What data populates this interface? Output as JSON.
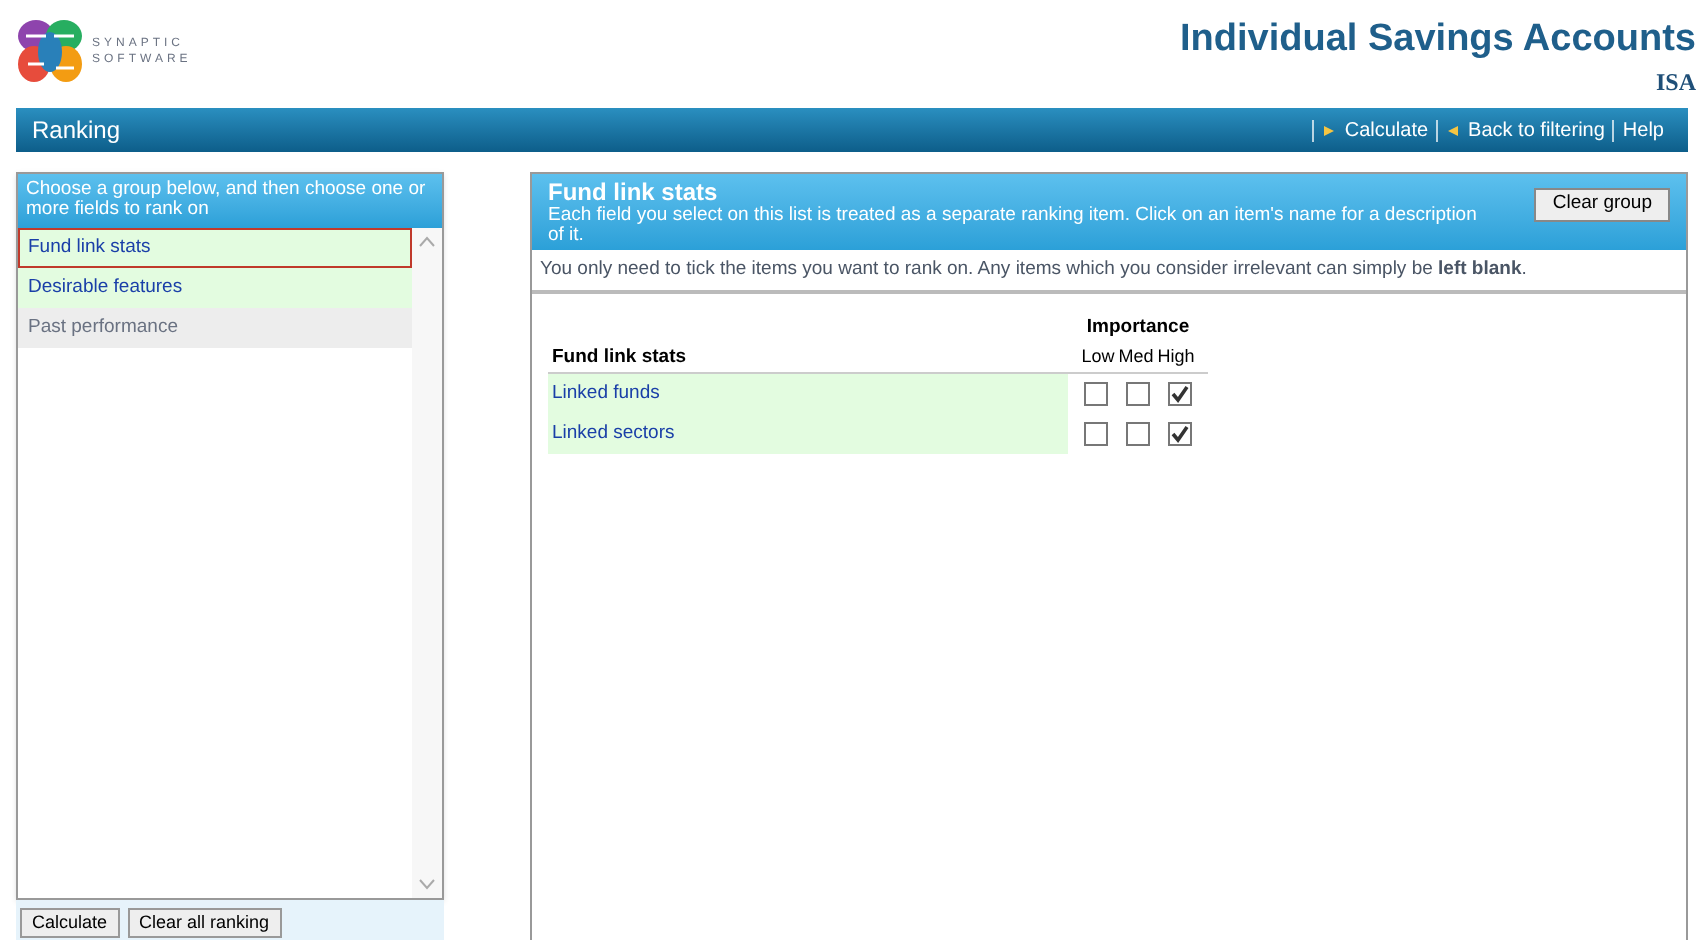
{
  "brand": {
    "line_1": "SYNAPTIC",
    "line_2": "SOFTWARE"
  },
  "header": {
    "title": "Individual Savings Accounts",
    "subtitle": "ISA"
  },
  "toolbar": {
    "title": "Ranking",
    "links": [
      {
        "label": "Calculate",
        "kind": "calc"
      },
      {
        "label": "Back to filtering",
        "kind": "back"
      },
      {
        "label": "Help",
        "kind": "plain"
      }
    ]
  },
  "groups_panel": {
    "heading": "Choose a group below, and then choose one or more fields to rank on",
    "items": [
      {
        "label": "Fund link stats",
        "selected": true,
        "disabled": false
      },
      {
        "label": "Desirable features",
        "selected": false,
        "disabled": false
      },
      {
        "label": "Past performance",
        "selected": false,
        "disabled": true
      }
    ],
    "buttons": [
      "Calculate",
      "Clear all ranking"
    ]
  },
  "detail_panel": {
    "title": "Fund link stats",
    "description": "Each field you select on this list is treated as a separate ranking item. Click on an item's name for a description of it.",
    "clear_button": "Clear group",
    "hint": "You only need to tick the items you want to rank on. Any items which you consider irrelevant can simply be **left blank**.",
    "table": {
      "heading": "Fund link stats",
      "group_heading": "Importance",
      "columns": [
        "Low",
        "Med",
        "High"
      ],
      "rows": [
        {
          "label": "Linked funds",
          "checks": [
            false,
            false,
            true
          ]
        },
        {
          "label": "Linked sectors",
          "checks": [
            false,
            false,
            true
          ]
        }
      ]
    }
  }
}
